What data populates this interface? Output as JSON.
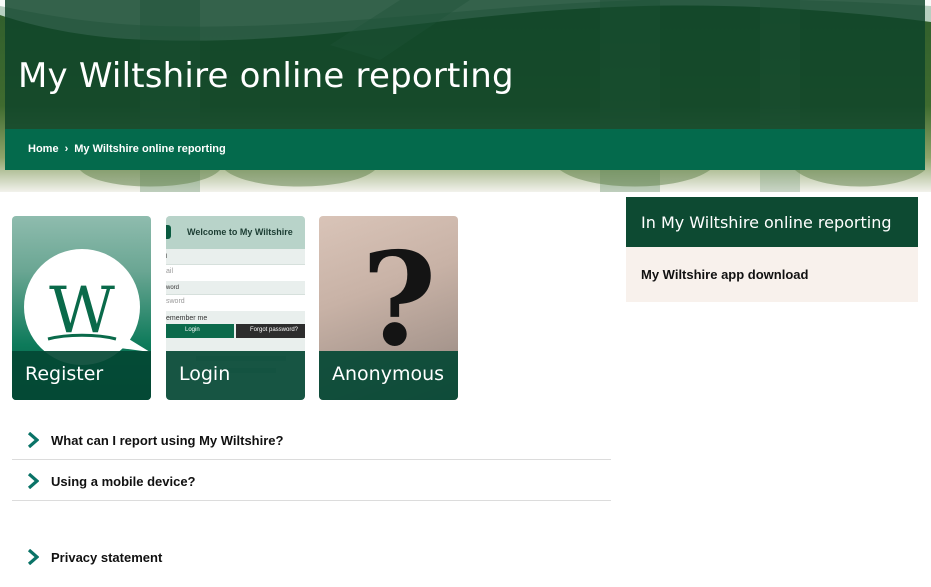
{
  "header": {
    "title": "My Wiltshire online reporting"
  },
  "breadcrumb": {
    "home": "Home",
    "separator": "›",
    "current": "My Wiltshire online reporting"
  },
  "tiles": [
    {
      "label": "Register",
      "icon": "w-logo-icon"
    },
    {
      "label": "Login",
      "icon": "login-screenshot"
    },
    {
      "label": "Anonymous",
      "icon": "question-mark-icon"
    }
  ],
  "login_mock": {
    "heading": "Welcome to My Wiltshire",
    "email_label": "l",
    "email_placeholder": "ail",
    "password_label": "word",
    "password_placeholder": "sword",
    "remember": "emember me",
    "login_button": "Login",
    "forgot_button": "Forgot password?"
  },
  "register_logo_letter": "W",
  "anonymous_glyph": "?",
  "accordion": [
    {
      "label": "What can I report using My Wiltshire?"
    },
    {
      "label": "Using a mobile device?"
    }
  ],
  "privacy": {
    "label": "Privacy statement"
  },
  "sidebar": {
    "title": "In My Wiltshire online reporting",
    "links": [
      {
        "label": "My Wiltshire app download"
      }
    ]
  },
  "colors": {
    "dark_green": "#0d4a32",
    "brand_green": "#046a4c",
    "chevron_teal": "#0a7367",
    "sidebar_bg": "#f8f1ec"
  }
}
